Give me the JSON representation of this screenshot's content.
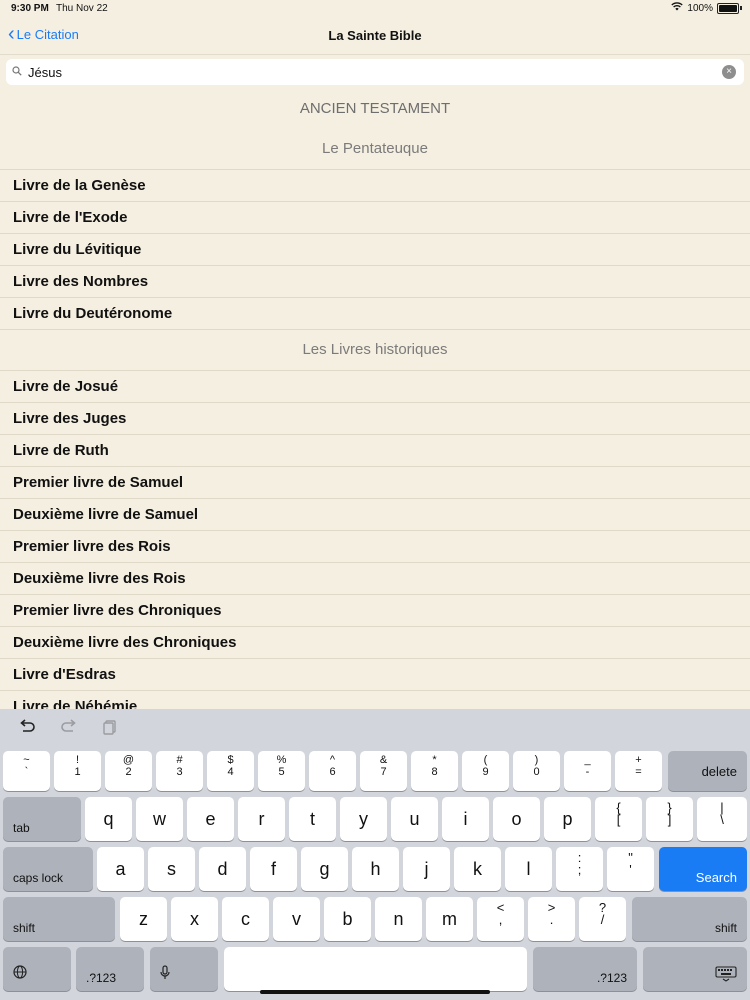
{
  "status": {
    "time": "9:30 PM",
    "date": "Thu Nov 22",
    "battery": "100%"
  },
  "nav": {
    "back_label": "Le Citation",
    "title": "La Sainte Bible"
  },
  "search": {
    "value": "Jésus"
  },
  "list": {
    "testament": "ANCIEN TESTAMENT",
    "sections": [
      {
        "title": "Le Pentateuque",
        "items": [
          "Livre de la Genèse",
          "Livre de l'Exode",
          "Livre du Lévitique",
          "Livre des Nombres",
          "Livre du Deutéronome"
        ]
      },
      {
        "title": "Les Livres historiques",
        "items": [
          "Livre de Josué",
          "Livre des Juges",
          "Livre de Ruth",
          "Premier livre de Samuel",
          "Deuxième livre de Samuel",
          "Premier livre des Rois",
          "Deuxième livre des Rois",
          "Premier livre des Chroniques",
          "Deuxième livre des Chroniques",
          "Livre d'Esdras",
          "Livre de Néhémie"
        ]
      }
    ]
  },
  "keyboard": {
    "row1": [
      [
        "~",
        "`"
      ],
      [
        "!",
        "1"
      ],
      [
        "@",
        "2"
      ],
      [
        "#",
        "3"
      ],
      [
        "$",
        "4"
      ],
      [
        "%",
        "5"
      ],
      [
        "^",
        "6"
      ],
      [
        "&",
        "7"
      ],
      [
        "*",
        "8"
      ],
      [
        "(",
        "9"
      ],
      [
        ")",
        "0"
      ],
      [
        "_",
        "-"
      ],
      [
        "+",
        "="
      ]
    ],
    "delete": "delete",
    "tab": "tab",
    "row2": [
      "q",
      "w",
      "e",
      "r",
      "t",
      "y",
      "u",
      "i",
      "o",
      "p"
    ],
    "row2_sym": [
      [
        "{",
        "["
      ],
      [
        "}",
        "]"
      ],
      [
        "|",
        "\\"
      ]
    ],
    "caps": "caps lock",
    "row3": [
      "a",
      "s",
      "d",
      "f",
      "g",
      "h",
      "j",
      "k",
      "l"
    ],
    "row3_sym": [
      [
        ":",
        ";"
      ],
      [
        "\"",
        "'"
      ]
    ],
    "search": "Search",
    "shift": "shift",
    "row4": [
      "z",
      "x",
      "c",
      "v",
      "b",
      "n",
      "m"
    ],
    "row4_sym": [
      [
        "<",
        ","
      ],
      [
        ">",
        "."
      ],
      [
        "?",
        "/"
      ]
    ],
    "numbers": ".?123"
  }
}
